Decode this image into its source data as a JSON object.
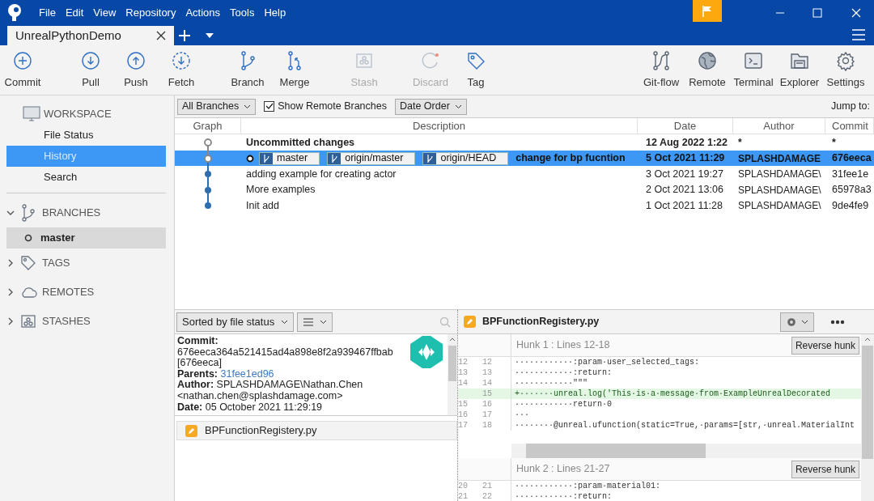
{
  "menu": [
    "File",
    "Edit",
    "View",
    "Repository",
    "Actions",
    "Tools",
    "Help"
  ],
  "tab": {
    "title": "UnrealPythonDemo",
    "selected": true
  },
  "toolbar_left": [
    {
      "label": "Commit",
      "disabled": false
    },
    {
      "label": "Pull",
      "disabled": false
    },
    {
      "label": "Push",
      "disabled": false
    },
    {
      "label": "Fetch",
      "disabled": false
    },
    {
      "label": "Branch",
      "disabled": false
    },
    {
      "label": "Merge",
      "disabled": false
    },
    {
      "label": "Stash",
      "disabled": true
    },
    {
      "label": "Discard",
      "disabled": true
    },
    {
      "label": "Tag",
      "disabled": false
    }
  ],
  "toolbar_right": [
    {
      "label": "Git-flow"
    },
    {
      "label": "Remote"
    },
    {
      "label": "Terminal"
    },
    {
      "label": "Explorer"
    },
    {
      "label": "Settings"
    }
  ],
  "sidebar": {
    "workspace": {
      "title": "WORKSPACE",
      "items": [
        {
          "label": "File Status",
          "selected": false
        },
        {
          "label": "History",
          "selected": true
        },
        {
          "label": "Search",
          "selected": false
        }
      ]
    },
    "sections": [
      {
        "title": "BRANCHES",
        "expanded": true,
        "items": [
          {
            "label": "master",
            "selected": true
          }
        ]
      },
      {
        "title": "TAGS",
        "expanded": false
      },
      {
        "title": "REMOTES",
        "expanded": false
      },
      {
        "title": "STASHES",
        "expanded": false
      }
    ]
  },
  "filters": {
    "branches": "All Branches",
    "show_remote": {
      "label": "Show Remote Branches",
      "checked": true
    },
    "order": "Date Order",
    "jump": "Jump to:"
  },
  "table": {
    "columns": [
      "Graph",
      "Description",
      "Date",
      "Author",
      "Commit"
    ],
    "rows": [
      {
        "kind": "uncommitted",
        "selected": false,
        "refs": [],
        "description": "Uncommitted changes",
        "date": "12 Aug 2022 1:22",
        "author": "*",
        "commit": "*"
      },
      {
        "kind": "head",
        "selected": true,
        "refs": [
          "master",
          "origin/master",
          "origin/HEAD"
        ],
        "description": "change for bp fucntion",
        "date": "5 Oct 2021 11:29",
        "author": "SPLASHDAMAGE",
        "commit": "676eeca"
      },
      {
        "kind": "commit",
        "selected": false,
        "refs": [],
        "description": "adding example for creating actor",
        "date": "3 Oct 2021 19:27",
        "author": "SPLASHDAMAGE\\",
        "commit": "31fee1e"
      },
      {
        "kind": "commit",
        "selected": false,
        "refs": [],
        "description": "More examples",
        "date": "2 Oct 2021 13:06",
        "author": "SPLASHDAMAGE\\",
        "commit": "65978a3"
      },
      {
        "kind": "commit",
        "selected": false,
        "refs": [],
        "description": "Init add",
        "date": "1 Oct 2021 11:28",
        "author": "SPLASHDAMAGE\\",
        "commit": "9de4fe9"
      }
    ]
  },
  "details": {
    "sort": "Sorted by file status",
    "lines": [
      {
        "label": "Commit:"
      },
      {
        "value": "676eeca364a521415ad4a898e8f2a939467ffbab"
      },
      {
        "value": "[676eeca]"
      },
      {
        "label": "Parents:",
        "value": "31fee1ed96",
        "link": true
      },
      {
        "label": "Author:",
        "value": "SPLASHDAMAGE\\Nathan.Chen"
      },
      {
        "value": "<nathan.chen@splashdamage.com>"
      },
      {
        "label": "Date:",
        "value": "05 October 2021 11:29:19"
      }
    ],
    "files": [
      {
        "name": "BPFunctionRegistery.py"
      }
    ]
  },
  "diff": {
    "file": "BPFunctionRegistery.py",
    "hunks": [
      {
        "title": "Hunk 1 : Lines 12-18",
        "button": "Reverse hunk",
        "lines": [
          {
            "old": "12",
            "new": "12",
            "kind": "context",
            "text": "············:param·user_selected_tags:"
          },
          {
            "old": "13",
            "new": "13",
            "kind": "context",
            "text": "············:return:"
          },
          {
            "old": "14",
            "new": "14",
            "kind": "context",
            "text": "············\"\"\""
          },
          {
            "new": "15",
            "kind": "added",
            "text": "+·······unreal.log('This·is·a·message·from·ExampleUnrealDecorated"
          },
          {
            "old": "15",
            "new": "16",
            "kind": "context",
            "text": "············return·0"
          },
          {
            "old": "16",
            "new": "17",
            "kind": "context",
            "text": "···"
          },
          {
            "old": "17",
            "new": "18",
            "kind": "context",
            "text": "········@unreal.ufunction(static=True,·params=[str,·unreal.MaterialInt"
          }
        ]
      },
      {
        "title": "Hunk 2 : Lines 21-27",
        "button": "Reverse hunk",
        "lines": [
          {
            "old": "20",
            "new": "21",
            "kind": "context",
            "text": "············:param·material01:"
          },
          {
            "old": "21",
            "new": "22",
            "kind": "context",
            "text": "············:return:"
          }
        ]
      }
    ]
  }
}
